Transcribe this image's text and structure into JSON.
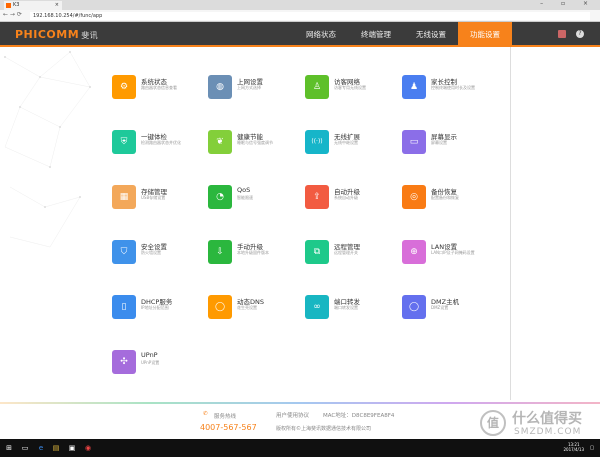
{
  "browser": {
    "tab_title": "K3",
    "url": "192.168.10.254/#/func/app"
  },
  "header": {
    "brand": "PHICOMM",
    "brand_cn": "斐讯",
    "nav": [
      "网络状态",
      "终端管理",
      "无线设置",
      "功能设置"
    ],
    "active": "功能设置",
    "accent": "#f7821b"
  },
  "features": [
    {
      "title": "系统状态",
      "desc": "路由器状态信息查看",
      "icon": "system-status-icon",
      "color": "#ff9a00"
    },
    {
      "title": "上网设置",
      "desc": "上网方式选择",
      "icon": "globe-icon",
      "color": "#6b8fb5"
    },
    {
      "title": "访客网络",
      "desc": "访客专用无线设置",
      "icon": "guest-icon",
      "color": "#5ec02a"
    },
    {
      "title": "家长控制",
      "desc": "控制终端使用时长及设置",
      "icon": "parent-icon",
      "color": "#4a7ef0"
    },
    {
      "title": "一键体检",
      "desc": "检测路由器状态并优化",
      "icon": "shield-plus-icon",
      "color": "#1ec99a"
    },
    {
      "title": "健康节能",
      "desc": "睡眠与信号强度调节",
      "icon": "leaf-icon",
      "color": "#83cf3a"
    },
    {
      "title": "无线扩展",
      "desc": "无线中继设置",
      "icon": "wireless-icon",
      "color": "#16b5c9"
    },
    {
      "title": "屏幕显示",
      "desc": "屏幕设置",
      "icon": "screen-icon",
      "color": "#8b6ee8"
    },
    {
      "title": "存储管理",
      "desc": "USB存储设置",
      "icon": "storage-icon",
      "color": "#f3a85a"
    },
    {
      "title": "QoS",
      "desc": "智能限速",
      "icon": "qos-icon",
      "color": "#2bb73e"
    },
    {
      "title": "自动升级",
      "desc": "系统自动升级",
      "icon": "auto-upgrade-icon",
      "color": "#f25b41"
    },
    {
      "title": "备份恢复",
      "desc": "配置备份和恢复",
      "icon": "backup-icon",
      "color": "#f97b14"
    },
    {
      "title": "安全设置",
      "desc": "防火墙设置",
      "icon": "security-icon",
      "color": "#3f92ea"
    },
    {
      "title": "手动升级",
      "desc": "本地升级固件版本",
      "icon": "manual-upgrade-icon",
      "color": "#2bb73e"
    },
    {
      "title": "远程管理",
      "desc": "远程管理开关",
      "icon": "remote-icon",
      "color": "#1ec98a"
    },
    {
      "title": "LAN设置",
      "desc": "LAN口IP及子网掩码设置",
      "icon": "lan-icon",
      "color": "#d86ed9"
    },
    {
      "title": "DHCP服务",
      "desc": "IP地址分配范围",
      "icon": "dhcp-icon",
      "color": "#3b8ced"
    },
    {
      "title": "动态DNS",
      "desc": "花生壳设置",
      "icon": "ddns-icon",
      "color": "#ff9a00"
    },
    {
      "title": "端口转发",
      "desc": "端口转发设置",
      "icon": "port-forward-icon",
      "color": "#18b6c2"
    },
    {
      "title": "DMZ主机",
      "desc": "DMZ设置",
      "icon": "dmz-icon",
      "color": "#6470ee"
    },
    {
      "title": "UPnP",
      "desc": "UPnP设置",
      "icon": "upnp-icon",
      "color": "#a56cdc"
    }
  ],
  "footer": {
    "hotline_label": "服务热线",
    "hotline": "4007-567-567",
    "agreement": "用户使用协议",
    "mac": "MAC地址：D8C8E9FEA8F4",
    "copyright": "版权所有©上海斐讯数据通信技术有限公司"
  },
  "watermark": {
    "cn": "什么值得买",
    "en": "SMZDM.COM"
  },
  "taskbar": {
    "time": "13:21",
    "date": "2017/4/13"
  }
}
